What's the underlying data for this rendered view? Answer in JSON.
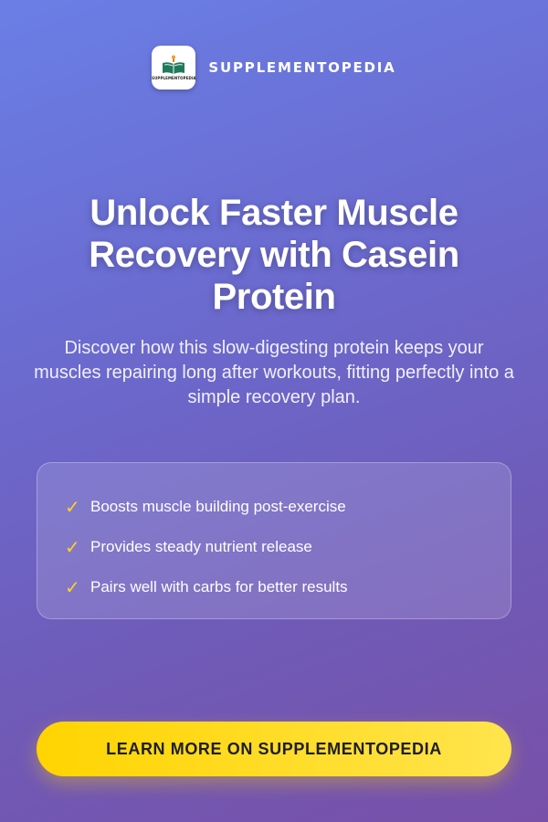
{
  "brand": {
    "name": "SUPPLEMENTOPEDIA",
    "logo_text": "SUPPLEMENTOPEDIA",
    "logo_icon": "open-book-icon"
  },
  "headline": "Unlock Faster Muscle Recovery with Casein Protein",
  "subtitle": "Discover how this slow-digesting protein keeps your muscles repairing long after workouts, fitting perfectly into a simple recovery plan.",
  "benefits": [
    {
      "icon": "check-icon",
      "label": "Boosts muscle building post-exercise"
    },
    {
      "icon": "check-icon",
      "label": "Provides steady nutrient release"
    },
    {
      "icon": "check-icon",
      "label": "Pairs well with carbs for better results"
    }
  ],
  "cta": {
    "label": "LEARN MORE ON SUPPLEMENTOPEDIA"
  },
  "colors": {
    "background_start": "#6a7fe6",
    "background_end": "#7850a8",
    "accent": "#ffd400",
    "text": "#ffffff",
    "cta_text": "#1d1d2b"
  }
}
